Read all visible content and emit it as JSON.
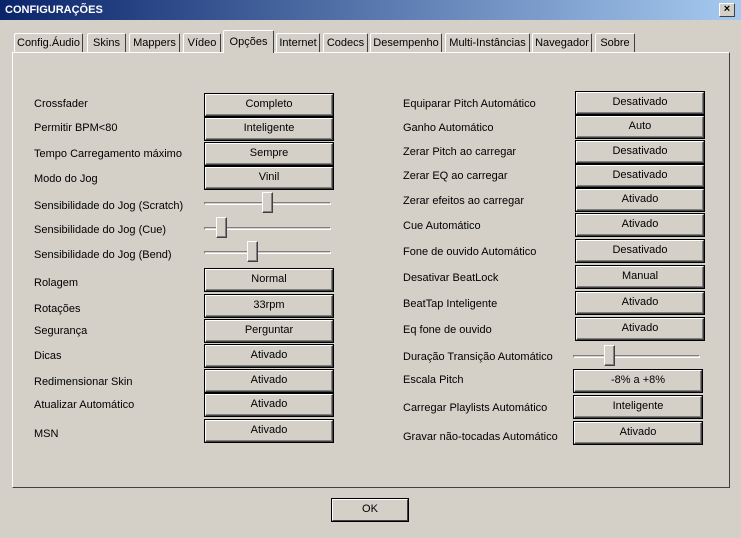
{
  "window": {
    "title": "CONFIGURAÇÕES",
    "close_glyph": "×"
  },
  "tabs": [
    {
      "label": "Config.Áudio",
      "active": false
    },
    {
      "label": "Skins",
      "active": false
    },
    {
      "label": "Mappers",
      "active": false
    },
    {
      "label": "Vídeo",
      "active": false
    },
    {
      "label": "Opções",
      "active": true
    },
    {
      "label": "Internet",
      "active": false
    },
    {
      "label": "Codecs",
      "active": false
    },
    {
      "label": "Desempenho",
      "active": false
    },
    {
      "label": "Multi-Instâncias",
      "active": false
    },
    {
      "label": "Navegador",
      "active": false
    },
    {
      "label": "Sobre",
      "active": false
    }
  ],
  "left": [
    {
      "label": "Crossfader",
      "value": "Completo"
    },
    {
      "label": "Permitir BPM<80",
      "value": "Inteligente"
    },
    {
      "label": "Tempo Carregamento máximo",
      "value": "Sempre"
    },
    {
      "label": "Modo do Jog",
      "value": "Vinil"
    },
    {
      "label": "Sensibilidade do Jog (Scratch)",
      "level": 0.5
    },
    {
      "label": "Sensibilidade do Jog (Cue)",
      "level": 0.1
    },
    {
      "label": "Sensibilidade do Jog (Bend)",
      "level": 0.37
    },
    {
      "label": "Rolagem",
      "value": "Normal"
    },
    {
      "label": "Rotações",
      "value": "33rpm"
    },
    {
      "label": "Segurança",
      "value": "Perguntar"
    },
    {
      "label": "Dicas",
      "value": "Ativado"
    },
    {
      "label": "Redimensionar Skin",
      "value": "Ativado"
    },
    {
      "label": "Atualizar Automático",
      "value": "Ativado"
    },
    {
      "label": "MSN",
      "value": "Ativado"
    }
  ],
  "right": [
    {
      "label": "Equiparar Pitch Automático",
      "value": "Desativado"
    },
    {
      "label": "Ganho Automático",
      "value": "Auto"
    },
    {
      "label": "Zerar Pitch ao carregar",
      "value": "Desativado"
    },
    {
      "label": "Zerar EQ ao carregar",
      "value": "Desativado"
    },
    {
      "label": "Zerar efeitos ao carregar",
      "value": "Ativado"
    },
    {
      "label": "Cue Automático",
      "value": "Ativado"
    },
    {
      "label": "Fone de ouvido Automático",
      "value": "Desativado"
    },
    {
      "label": "Desativar BeatLock",
      "value": "Manual"
    },
    {
      "label": "BeatTap Inteligente",
      "value": "Ativado"
    },
    {
      "label": "Eq fone de ouvido",
      "value": "Ativado"
    },
    {
      "label": "Duração Transição Automático",
      "level": 0.27
    },
    {
      "label": "Escala Pitch",
      "value": "-8% a +8%"
    },
    {
      "label": "Carregar Playlists Automático",
      "value": "Inteligente"
    },
    {
      "label": "Gravar não-tocadas Automático",
      "value": "Ativado"
    }
  ],
  "footer": {
    "ok_label": "OK"
  }
}
